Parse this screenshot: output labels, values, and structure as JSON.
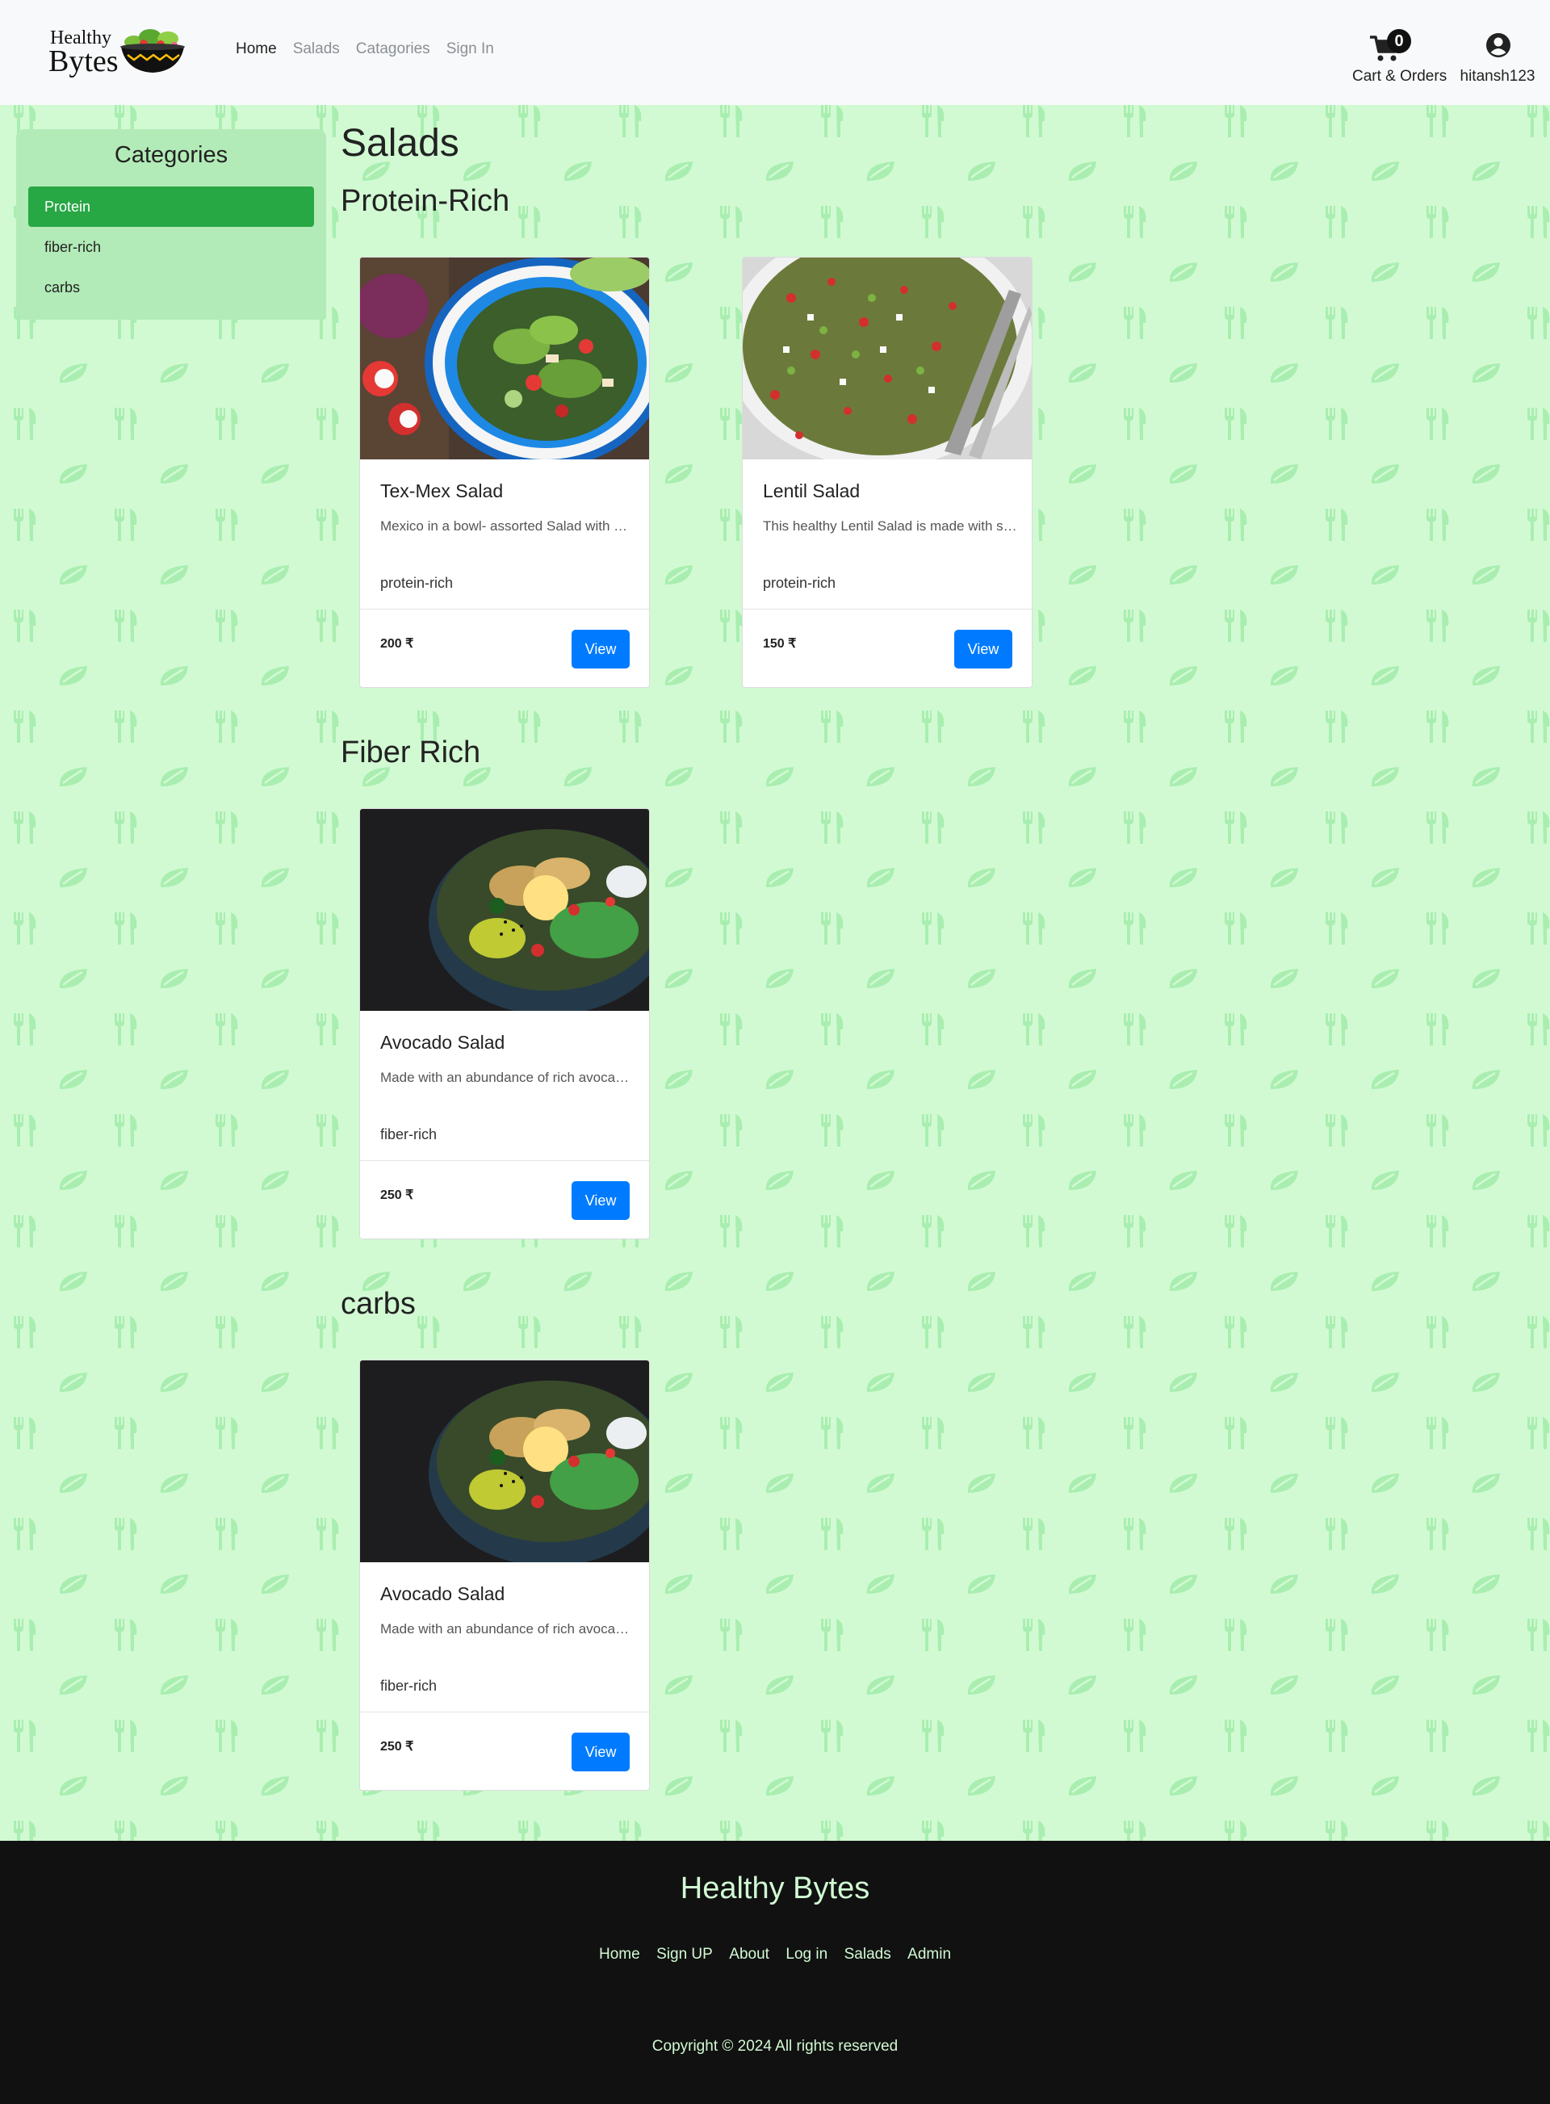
{
  "brand": {
    "line1": "Healthy",
    "line2": "Bytes",
    "logo_icon": "salad-bowl-icon"
  },
  "nav": {
    "links": [
      {
        "label": "Home",
        "active": true
      },
      {
        "label": "Salads",
        "active": false
      },
      {
        "label": "Catagories",
        "active": false
      },
      {
        "label": "Sign In",
        "active": false
      }
    ],
    "cart": {
      "count": "0",
      "label": "Cart & Orders",
      "icon": "cart-icon"
    },
    "user": {
      "name": "hitansh123",
      "icon": "user-circle-icon"
    }
  },
  "sidebar": {
    "title": "Categories",
    "items": [
      {
        "label": "Protein",
        "active": true
      },
      {
        "label": "fiber-rich",
        "active": false
      },
      {
        "label": "carbs",
        "active": false
      }
    ]
  },
  "main": {
    "title": "Salads",
    "sections": [
      {
        "title": "Protein-Rich",
        "cards": [
          {
            "name": "Tex-Mex Salad",
            "desc": "Mexico in a bowl- assorted Salad with beans and veggies",
            "tag": "protein-rich",
            "price": "200 ₹",
            "button": "View",
            "image": "tex-mex-salad-photo"
          },
          {
            "name": "Lentil Salad",
            "desc": "This healthy Lentil Salad is made with sprouted lentils",
            "tag": "protein-rich",
            "price": "150 ₹",
            "button": "View",
            "image": "lentil-salad-photo"
          }
        ]
      },
      {
        "title": "Fiber Rich",
        "cards": [
          {
            "name": "Avocado Salad",
            "desc": "Made with an abundance of rich avocado and greens",
            "tag": "fiber-rich",
            "price": "250 ₹",
            "button": "View",
            "image": "avocado-salad-photo"
          }
        ]
      },
      {
        "title": "carbs",
        "cards": [
          {
            "name": "Avocado Salad",
            "desc": "Made with an abundance of rich avocado and greens",
            "tag": "fiber-rich",
            "price": "250 ₹",
            "button": "View",
            "image": "avocado-salad-photo"
          }
        ]
      }
    ]
  },
  "footer": {
    "title": "Healthy Bytes",
    "links": [
      "Home",
      "Sign UP",
      "About",
      "Log in",
      "Salads",
      "Admin"
    ],
    "copyright": "Copyright © 2024 All rights reserved"
  },
  "colors": {
    "background": "#d1fad3",
    "sidebar": "#b2ebb7",
    "active_green": "#28a745",
    "button_blue": "#007bff",
    "footer_bg": "#111111",
    "footer_text": "#d1fad3"
  }
}
